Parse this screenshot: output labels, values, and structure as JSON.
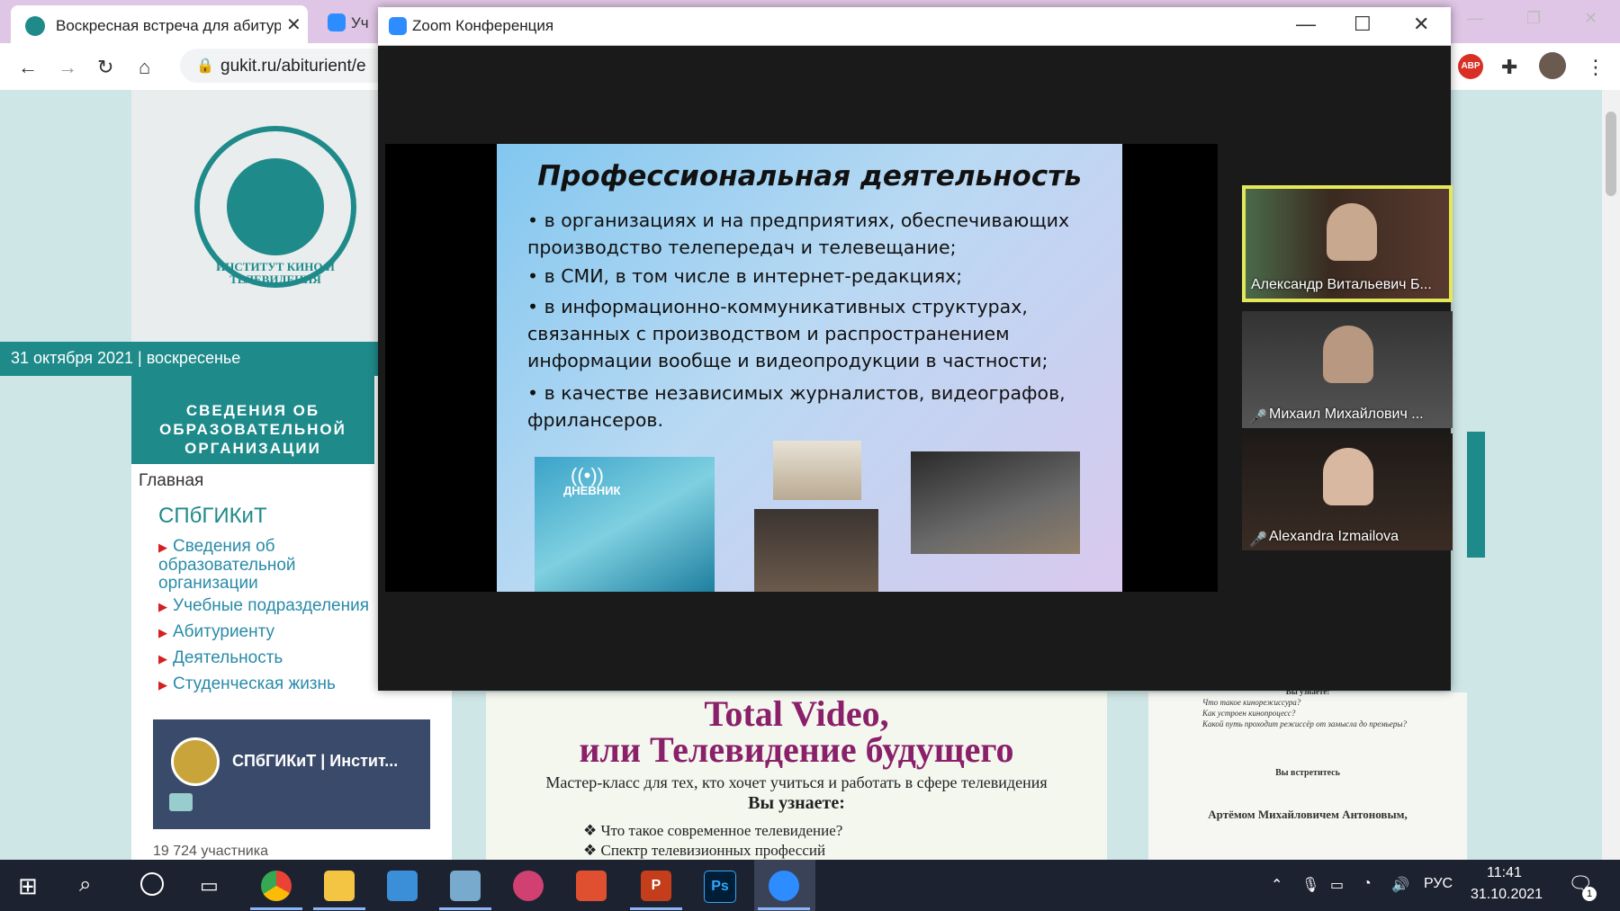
{
  "browser": {
    "active_tab_title": "Воскресная встреча для абитур",
    "inactive_tab_title": "Уч",
    "url": "gukit.ru/abiturient/e",
    "abp_label": "ABP"
  },
  "page": {
    "logo_caption": "ИНСТИТУТ КИНО И ТЕЛЕВИДЕНИЯ",
    "date_text": "31 октября 2021 | воскресенье",
    "org_info": "СВЕДЕНИЯ ОБ ОБРАЗОВАТЕЛЬНОЙ ОРГАНИЗАЦИИ",
    "nav_home": "Главная",
    "nav_brand": "СПбГИКиТ",
    "nav_items": [
      "Сведения об образовательной организации",
      "Учебные подразделения",
      "Абитуриенту",
      "Деятельность",
      "Студенческая жизнь"
    ],
    "vk_title": "СПбГИКиТ | Инстит...",
    "vk_members": "19 724 участника",
    "poster": {
      "title_line1": "Total Video,",
      "title_line2": "или Телевидение будущего",
      "subtitle": "Мастер-класс для тех, кто хочет учиться и работать в сфере телевидения",
      "learn": "Вы узнаете:",
      "bullets": [
        "Что такое современное телевидение?",
        "Спектр телевизионных профессий"
      ]
    },
    "right_poster": {
      "heading": "Вы узнаете:",
      "lines": [
        "Что такое кинорежиссура?",
        "Как устроен кинопроцесс?",
        "Какой путь проходит режиссёр от замысла до премьеры?"
      ],
      "meet_heading": "Вы встретитесь",
      "host": "Артёмом Михайловичем Антоновым,"
    }
  },
  "zoom": {
    "window_title": "Zoom Конференция",
    "slide": {
      "title": "Профессиональная деятельность",
      "bullets": [
        "• в организациях и на предприятиях, обеспечивающих производство телепередач и телевещание;",
        "• в СМИ, в том числе в интернет-редакциях;",
        "• в информационно-коммуникативных структурах, связанных с производством и распространением информации вообще и видеопродукции в частности;",
        "• в качестве независимых журналистов, видеографов, фрилансеров."
      ],
      "diary_label": "ДНЕВНИК"
    },
    "participants": [
      {
        "name": "Александр Витальевич Б...",
        "muted": false,
        "active": true
      },
      {
        "name": "Михаил Михайлович ...",
        "muted": true,
        "active": false
      },
      {
        "name": "Alexandra Izmailova",
        "muted": true,
        "active": false
      }
    ]
  },
  "taskbar": {
    "lang": "РУС",
    "time": "11:41",
    "date": "31.10.2021",
    "notif_count": "1"
  },
  "colors": {
    "teal": "#1f8a8a",
    "poster_title": "#8a1f6a",
    "active_speaker": "#e3e85a"
  }
}
